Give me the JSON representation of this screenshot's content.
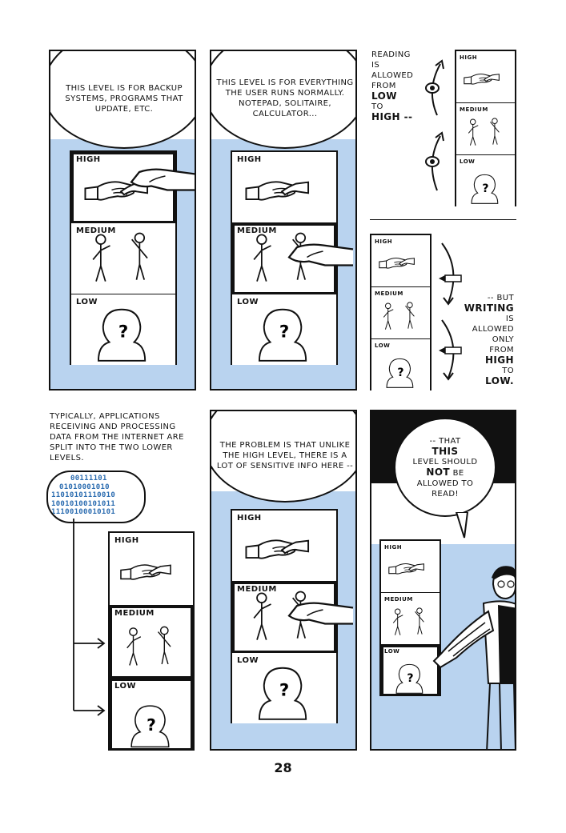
{
  "colors": {
    "panel_blue": "#b9d3ef",
    "ink": "#111111",
    "binary_blue": "#2b6cb0"
  },
  "levels": {
    "high": "HIGH",
    "medium": "MEDIUM",
    "low": "LOW"
  },
  "panel1": {
    "speech": "THIS LEVEL IS FOR BACKUP SYSTEMS, PROGRAMS THAT UPDATE, ETC."
  },
  "panel2": {
    "speech": "THIS LEVEL IS FOR EVERYTHING THE USER RUNS NORMALLY. NOTEPAD, SOLITAIRE, CALCULATOR..."
  },
  "panel3": {
    "reading": "READING",
    "is": "IS",
    "allowed": "ALLOWED",
    "from": "FROM",
    "low": "LOW",
    "to": "TO",
    "high": "HIGH --"
  },
  "panel4": {
    "but": "-- BUT",
    "writing": "WRITING",
    "is": "IS",
    "allowed": "ALLOWED",
    "only": "ONLY",
    "from": "FROM",
    "high": "HIGH",
    "to": "TO",
    "low": "LOW."
  },
  "panel5": {
    "caption": "TYPICALLY, APPLICATIONS RECEIVING AND PROCESSING DATA FROM THE INTERNET ARE SPLIT INTO THE TWO LOWER LEVELS.",
    "binary": [
      "00111101",
      "01010001010",
      "11010101110010",
      "10010100101011",
      "11100100010101"
    ]
  },
  "panel6": {
    "speech": "THE PROBLEM IS THAT UNLIKE THE HIGH LEVEL, THERE IS A LOT OF SENSITIVE INFO HERE --"
  },
  "panel7": {
    "line1": "-- THAT",
    "line2": "THIS",
    "line3": "LEVEL SHOULD",
    "line4a": "NOT",
    "line4b": "BE",
    "line5": "ALLOWED TO",
    "line6": "READ!"
  },
  "question_mark": "?",
  "page_number": "28"
}
